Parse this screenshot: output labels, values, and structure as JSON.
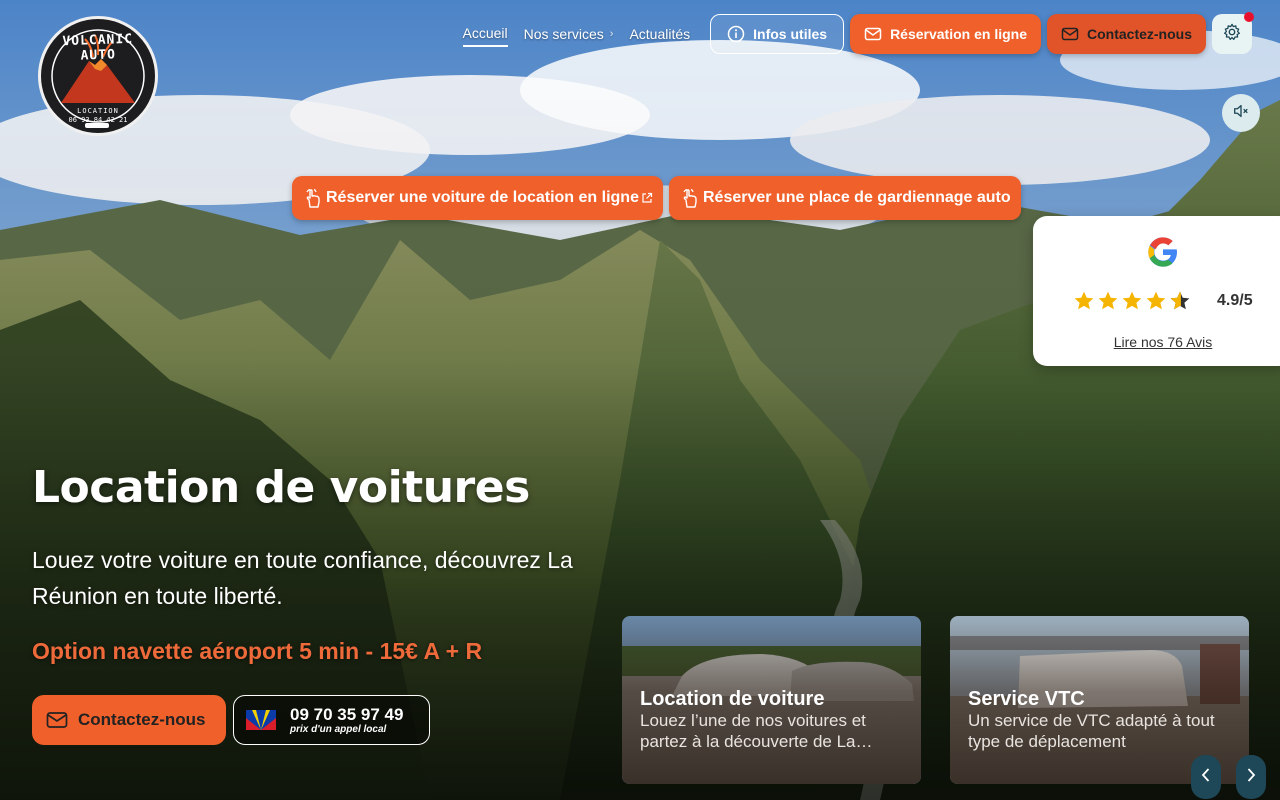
{
  "logo": {
    "brand": "VOLCANIC AUTO",
    "subtitle": "LOCATION",
    "phone": "06 93 84 42 21"
  },
  "nav": {
    "items": [
      {
        "label": "Accueil",
        "active": true
      },
      {
        "label": "Nos services",
        "has_submenu": true
      },
      {
        "label": "Actualités"
      }
    ],
    "info_button": "Infos utiles",
    "booking_button": "Réservation en ligne",
    "contact_button": "Contactez-nous",
    "settings_icon": "gear-icon",
    "mute_icon": "speaker-muted-icon"
  },
  "cta": {
    "rent_online": "Réserver une voiture de location en ligne",
    "parking": "Réserver une place de gardiennage auto"
  },
  "reviews": {
    "provider_icon": "google-icon",
    "rating": "4.9/5",
    "rating_value": 4.9,
    "rating_max": 5,
    "link": "Lire nos 76 Avis"
  },
  "hero": {
    "title": "Location de voitures",
    "subtitle": "Louez votre voiture en toute confiance, découvrez La Réunion en toute liberté.",
    "option": "Option navette aéroport 5 min - 15€ A + R",
    "contact_button": "Contactez-nous",
    "phone": "09 70 35 97 49",
    "phone_note": "prix d'un appel local"
  },
  "cards": [
    {
      "title": "Location de voiture",
      "description": "Louez l’une de nos voitures et partez à la découverte de La Réunion"
    },
    {
      "title": "Service VTC",
      "description": "Un service de VTC adapté à tout type de déplacement"
    }
  ],
  "colors": {
    "accent": "#f0602b",
    "option_text": "#ee6a3a",
    "nav_arrow": "#1e4757",
    "notification": "#e8112d"
  }
}
